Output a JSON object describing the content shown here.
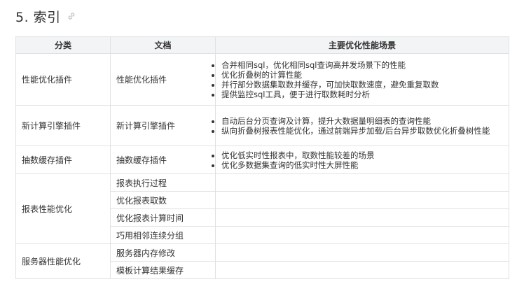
{
  "heading": {
    "title": "5. 索引"
  },
  "table": {
    "headers": [
      "分类",
      "文档",
      "主要优化性能场景"
    ],
    "groups": [
      {
        "category": "性能优化插件",
        "docs": [
          "性能优化插件"
        ],
        "scenarios": [
          "合并相同sql，优化相同sql查询高并发场景下的性能",
          "优化折叠树的计算性能",
          "并行部分数据集取数并缓存，可加快取数速度，避免重复取数",
          "提供监控sql工具，便于进行取数耗时分析"
        ]
      },
      {
        "category": "新计算引擎插件",
        "docs": [
          "新计算引擎插件"
        ],
        "scenarios": [
          "自动后台分页查询及计算，提升大数据量明细表的查询性能",
          "纵向折叠树报表性能优化，通过前端异步加载/后台异步取数优化折叠树性能"
        ]
      },
      {
        "category": "抽数缓存插件",
        "docs": [
          "抽数缓存插件"
        ],
        "scenarios": [
          "优化低实时性报表中，取数性能较差的场景",
          "优化多数据集查询的低实时性大屏性能"
        ]
      },
      {
        "category": "报表性能优化",
        "docs": [
          "报表执行过程",
          "优化报表取数",
          "优化报表计算时间",
          "巧用相邻连续分组"
        ],
        "scenarios": []
      },
      {
        "category": "服务器性能优化",
        "docs": [
          "服务器内存修改",
          "模板计算结果缓存"
        ],
        "scenarios": []
      }
    ]
  }
}
